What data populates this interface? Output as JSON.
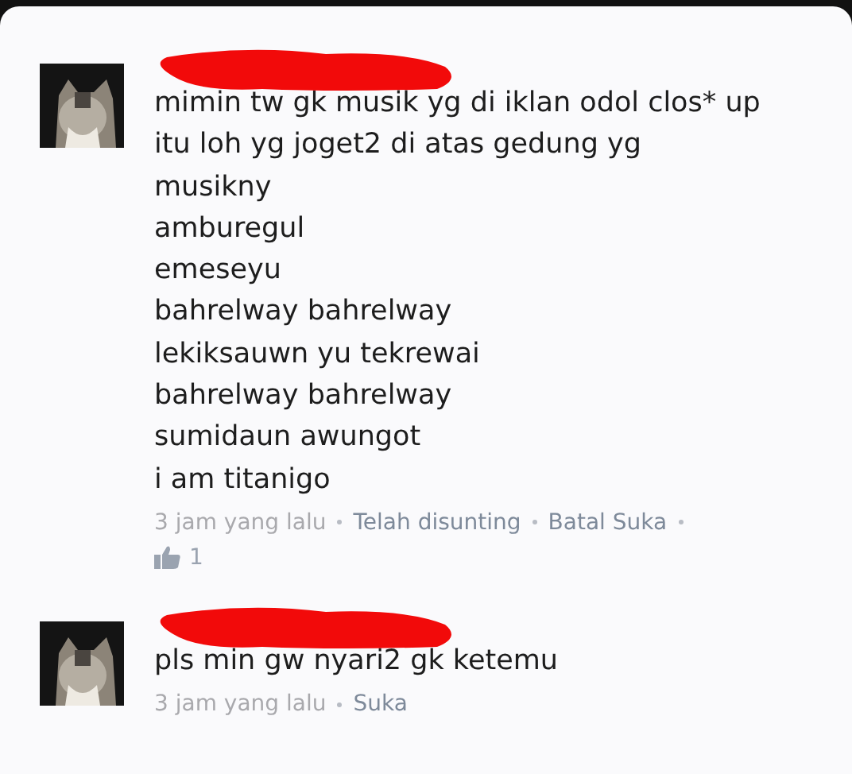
{
  "comments": [
    {
      "redacted": true,
      "body": [
        "mimin tw gk musik yg di iklan odol clos* up",
        "itu loh yg joget2 di atas gedung yg",
        "musikny",
        "amburegul",
        "emeseyu",
        "bahrelway bahrelway",
        "lekiksauwn yu tekrewai",
        "bahrelway bahrelway",
        "sumidaun awungot",
        "i am titanigo"
      ],
      "meta": [
        {
          "kind": "time",
          "text": "3 jam yang lalu"
        },
        {
          "kind": "link",
          "text": "Telah disunting"
        },
        {
          "kind": "link",
          "text": "Batal Suka"
        }
      ],
      "trailing_dot": true,
      "likes": "1"
    },
    {
      "redacted": true,
      "body": [
        "pls min gw nyari2 gk ketemu"
      ],
      "meta": [
        {
          "kind": "time",
          "text": "3 jam yang lalu"
        },
        {
          "kind": "link",
          "text": "Suka"
        }
      ],
      "trailing_dot": false
    }
  ]
}
